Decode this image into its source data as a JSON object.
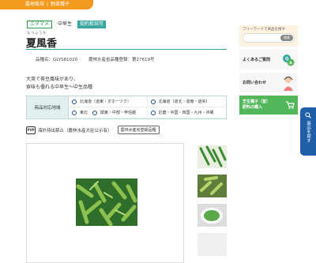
{
  "breadcrumb": {
    "items": [
      "品種検索",
      "露地栽培",
      "野菜種子"
    ]
  },
  "tags": {
    "a": "エダマメ",
    "b": "中早生",
    "c": "契約栽培可"
  },
  "product": {
    "ruby": "なつふうか",
    "name": "夏風香",
    "code": "品種名：GLYS81020",
    "registration": "農林水産省品種登録：第27619号",
    "desc": [
      "大莢で茶豆風味があり、",
      "食味も優れる中早生〜中生品種"
    ]
  },
  "region": {
    "header": "商品対応地域",
    "cells": [
      "北海道（道東・オホーツク）",
      "北海道（道北・道南・道央）",
      "東北",
      "関東・中部・甲信越",
      "近畿・中国・四国・九州・沖縄"
    ]
  },
  "pvp": {
    "badge": "PVP",
    "text": "海外持出禁止（農林水産大臣公示有）",
    "button": "農林水産省登録品種"
  },
  "sidebar": {
    "search_label": "フリーワードで商品を探す",
    "search_button": "検索",
    "faq": "よくあるご質問",
    "contact": "お問い合わせ",
    "buy": "芝生種子（苗）",
    "buy2": "肥料の購入"
  },
  "side_tab": {
    "label": "商品を探す"
  },
  "colors": {
    "orange": "#f39a1e",
    "teal": "#3aa6a1",
    "green": "#52b65a",
    "blue": "#1f5fa8"
  }
}
